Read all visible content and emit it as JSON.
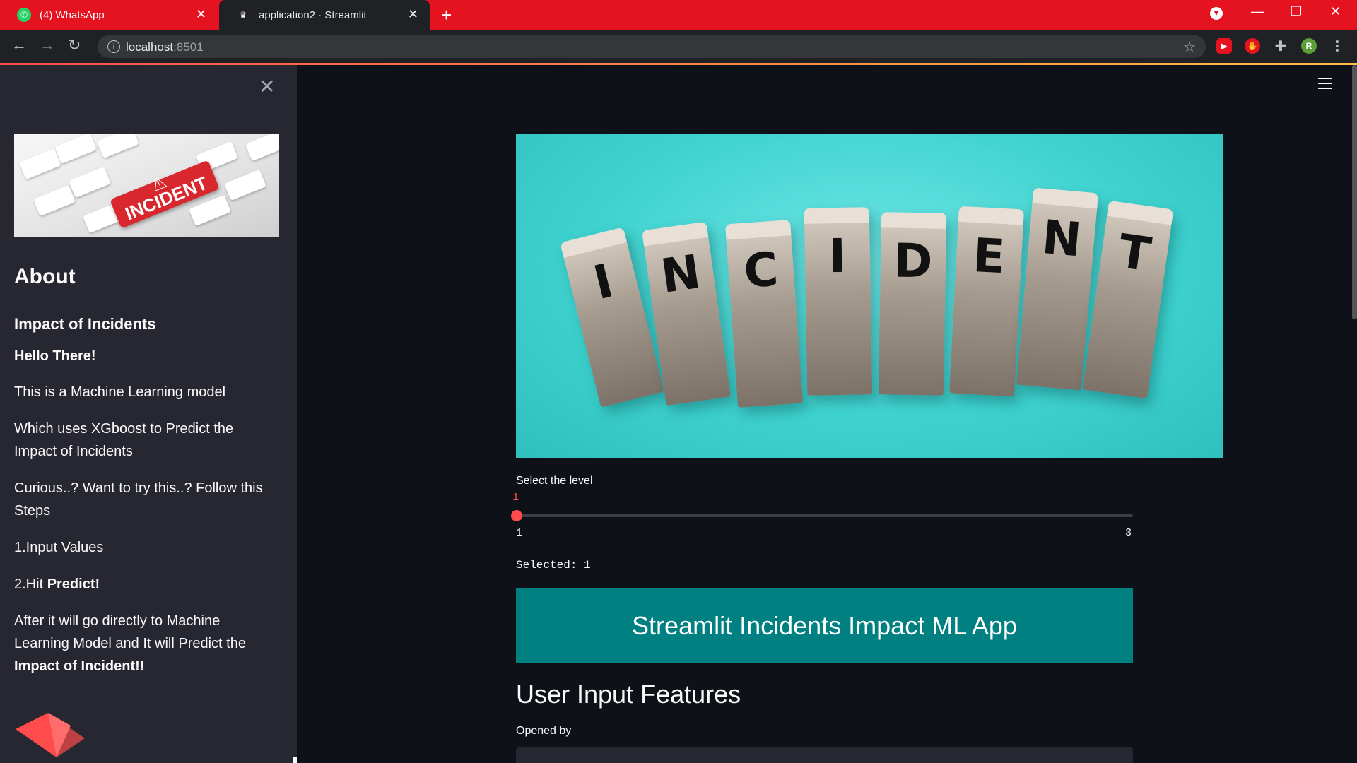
{
  "browser": {
    "tabs": [
      {
        "label": "(4) WhatsApp",
        "icon": "whatsapp-icon",
        "active": false
      },
      {
        "label": "application2 · Streamlit",
        "icon": "streamlit-icon",
        "active": true
      }
    ],
    "url_host": "localhost",
    "url_port": ":8501"
  },
  "sidebar": {
    "about_title": "About",
    "subtitle": "Impact of Incidents",
    "greeting": "Hello There!",
    "p1": "This is a Machine Learning model",
    "p2": "Which uses XGboost to Predict the Impact of Incidents",
    "p3": "Curious..? Want to try this..? Follow this Steps",
    "step1": "1.Input Values",
    "step2_prefix": "2.Hit ",
    "step2_bold": "Predict!",
    "p4_text": "After it will go directly to Machine Learning Model and It will Predict the",
    "p4_bold": "Impact of Incident!!",
    "image_key_label": "INCIDENT"
  },
  "main": {
    "hero_letters": [
      "I",
      "N",
      "C",
      "I",
      "D",
      "E",
      "N",
      "T"
    ],
    "slider": {
      "label": "Select the level",
      "value": "1",
      "min": "1",
      "max": "3"
    },
    "selected_text": "Selected: 1",
    "banner_title": "Streamlit Incidents Impact ML App",
    "section_title": "User Input Features",
    "opened_by_label": "Opened by"
  },
  "colors": {
    "chrome_red": "#e5121f",
    "streamlit_accent": "#ff4b4b",
    "banner_teal": "#008080",
    "sidebar_bg": "#262730",
    "main_bg": "#0e1117"
  }
}
